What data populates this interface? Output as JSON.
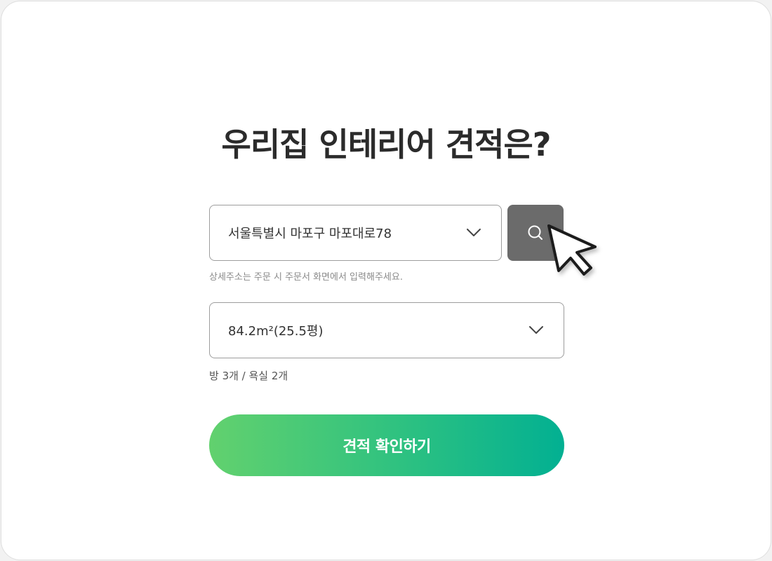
{
  "page": {
    "title": "우리집 인테리어 견적은?"
  },
  "address": {
    "value": "서울특별시 마포구 마포대로78",
    "hint": "상세주소는 주문 시 주문서 화면에서 입력해주세요.",
    "search_icon": "search-icon",
    "chevron_icon": "chevron-down-icon"
  },
  "area": {
    "value": "84.2m²(25.5평)",
    "info": "방 3개 / 욕실 2개",
    "chevron_icon": "chevron-down-icon"
  },
  "cta": {
    "label": "견적 확인하기"
  },
  "colors": {
    "search_button": "#6b6b6b",
    "cta_gradient_start": "#62d16e",
    "cta_gradient_end": "#02b092",
    "border": "#9d9d9d"
  }
}
